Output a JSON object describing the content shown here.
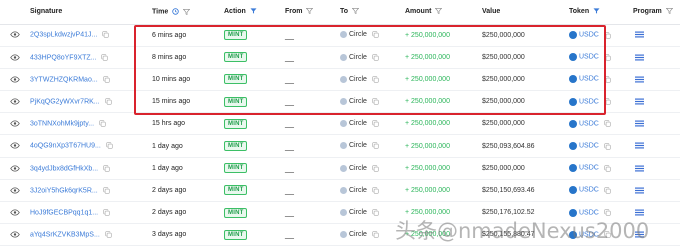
{
  "columns": {
    "signature": "Signature",
    "time": "Time",
    "action": "Action",
    "from": "From",
    "to": "To",
    "amount": "Amount",
    "value": "Value",
    "token": "Token",
    "program": "Program"
  },
  "rows": [
    {
      "signature": "2Q3spLkdwzjvP41J...",
      "time": "6 mins ago",
      "action": "MINT",
      "from": "__",
      "to": "Circle",
      "amount": "+ 250,000,000",
      "value": "$250,000,000",
      "token": "USDC"
    },
    {
      "signature": "433HPQ8oYF9XTZ...",
      "time": "8 mins ago",
      "action": "MINT",
      "from": "__",
      "to": "Circle",
      "amount": "+ 250,000,000",
      "value": "$250,000,000",
      "token": "USDC"
    },
    {
      "signature": "3YTWZHZQKRMao...",
      "time": "10 mins ago",
      "action": "MINT",
      "from": "__",
      "to": "Circle",
      "amount": "+ 250,000,000",
      "value": "$250,000,000",
      "token": "USDC"
    },
    {
      "signature": "PjKqQG2yWXvr7RK...",
      "time": "15 mins ago",
      "action": "MINT",
      "from": "__",
      "to": "Circle",
      "amount": "+ 250,000,000",
      "value": "$250,000,000",
      "token": "USDC"
    },
    {
      "signature": "3oTNNXohMk9jpty...",
      "time": "15 hrs ago",
      "action": "MINT",
      "from": "__",
      "to": "Circle",
      "amount": "+ 250,000,000",
      "value": "$250,000,000",
      "token": "USDC"
    },
    {
      "signature": "4oQG9nXp3T67HU9...",
      "time": "1 day ago",
      "action": "MINT",
      "from": "__",
      "to": "Circle",
      "amount": "+ 250,000,000",
      "value": "$250,093,604.86",
      "token": "USDC"
    },
    {
      "signature": "3q4ydJbx8dGfHkXb...",
      "time": "1 day ago",
      "action": "MINT",
      "from": "__",
      "to": "Circle",
      "amount": "+ 250,000,000",
      "value": "$250,000,000",
      "token": "USDC"
    },
    {
      "signature": "3J2oiY5hGk6qrK5R...",
      "time": "2 days ago",
      "action": "MINT",
      "from": "__",
      "to": "Circle",
      "amount": "+ 250,000,000",
      "value": "$250,150,693.46",
      "token": "USDC"
    },
    {
      "signature": "HoJ9fGECBPqq1q1...",
      "time": "2 days ago",
      "action": "MINT",
      "from": "__",
      "to": "Circle",
      "amount": "+ 250,000,000",
      "value": "$250,176,102.52",
      "token": "USDC"
    },
    {
      "signature": "aYq4SrKZVKB3MpS...",
      "time": "3 days ago",
      "action": "MINT",
      "from": "__",
      "to": "Circle",
      "amount": "+ 250,000,000",
      "value": "$250,155,880.47",
      "token": "USDC"
    }
  ],
  "watermark": "头条@nmadeNexus2000",
  "colors": {
    "link": "#3b7bd8",
    "mint_green": "#2bb55a",
    "highlight_red": "#d9232d",
    "usdc_blue": "#2775ca"
  },
  "icons": {
    "row": [
      "eye-icon",
      "copy-icon",
      "circle-icon",
      "usdc-icon",
      "program-icon"
    ],
    "header": [
      "clock-icon",
      "filter-icon"
    ]
  }
}
